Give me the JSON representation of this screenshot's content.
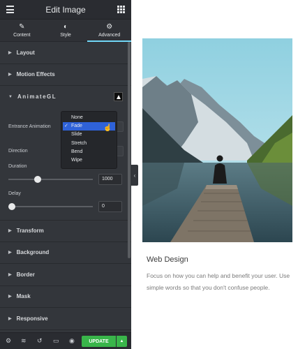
{
  "panel": {
    "title": "Edit Image",
    "tabs": [
      {
        "label": "Content",
        "icon": "pencil-icon"
      },
      {
        "label": "Style",
        "icon": "contrast-icon"
      },
      {
        "label": "Advanced",
        "icon": "gear-icon"
      }
    ],
    "active_tab": "Advanced",
    "sections_top": [
      "Layout",
      "Motion Effects"
    ],
    "animategl": {
      "title": "AnimateGL",
      "entrance_label": "Entrance Animation",
      "direction_label": "Direction",
      "duration_label": "Duration",
      "duration_value": "1000",
      "duration_fraction": 0.33,
      "delay_label": "Delay",
      "delay_value": "0",
      "delay_fraction": 0.0,
      "dropdown_options": [
        "None",
        "Fade",
        "Slide",
        "Stretch",
        "Bend",
        "Wipe"
      ],
      "selected_option": "Fade",
      "check_glyph": "✓"
    },
    "sections_bottom": [
      "Transform",
      "Background",
      "Border",
      "Mask",
      "Responsive"
    ],
    "update_label": "UPDATE",
    "collapse_glyph": "‹",
    "update_arrow_glyph": "▲",
    "bottom_icons": [
      "gear-icon",
      "layers-icon",
      "history-icon",
      "responsive-icon",
      "preview-icon"
    ]
  },
  "content": {
    "heading": "Web Design",
    "body": "Focus on how you can help and benefit your user. Use simple words so that you don't confuse people."
  },
  "colors": {
    "panel_bg": "#33363b",
    "accent_tab": "#71d7f7",
    "update_green": "#39b54a",
    "dropdown_selected": "#2f62d8"
  }
}
